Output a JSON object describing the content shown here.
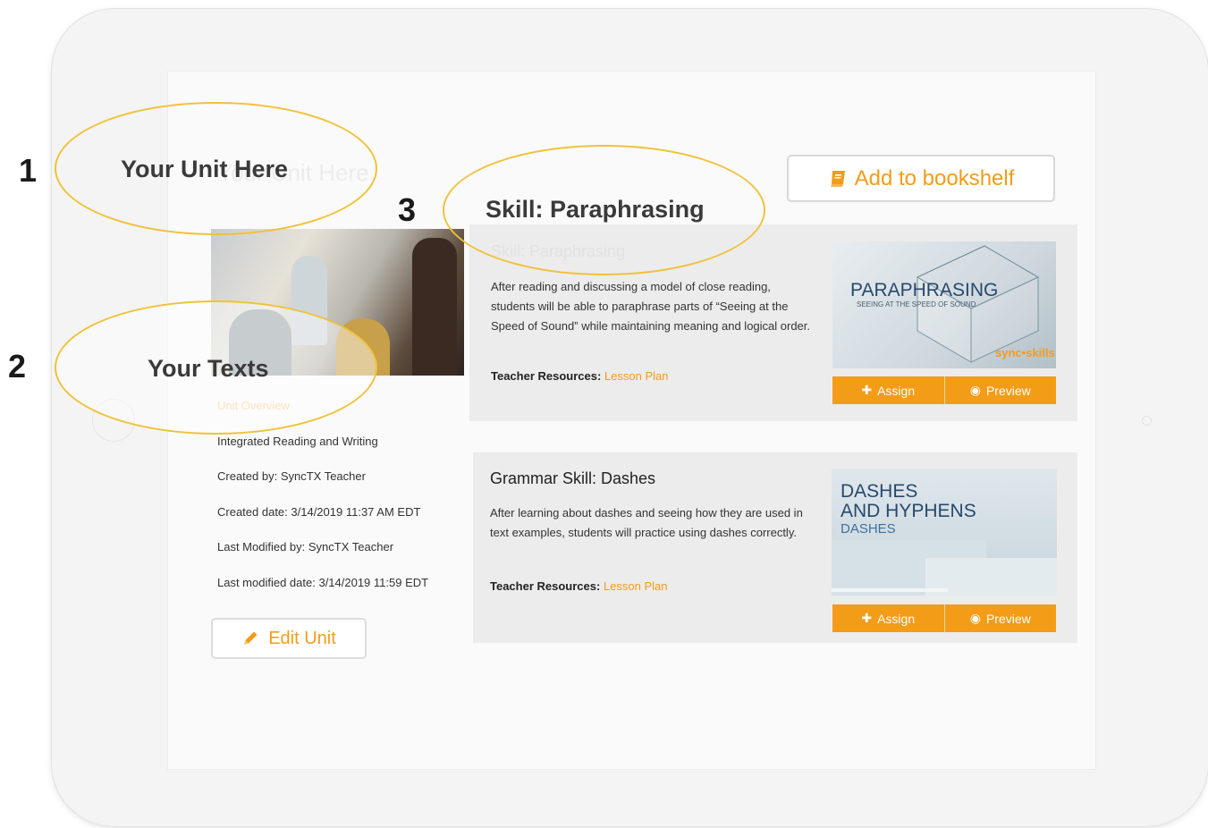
{
  "annotations": [
    {
      "number": "1",
      "label": "Your Unit Here"
    },
    {
      "number": "2",
      "label": "Your Texts"
    },
    {
      "number": "3",
      "label": "Skill: Paraphrasing"
    }
  ],
  "header": {
    "unit_title": "Your Unit Here",
    "add_bookshelf_label": "Add to bookshelf"
  },
  "unit": {
    "overview_link": "Unit Overview",
    "meta": [
      "Integrated Reading and Writing",
      "Created by: SyncTX Teacher",
      "Created date: 3/14/2019 11:37 AM EDT",
      "Last Modified by: SyncTX Teacher",
      "Last modified date: 3/14/2019 11:59 EDT"
    ],
    "edit_label": "Edit Unit"
  },
  "lessons": [
    {
      "title": "Skill: Paraphrasing",
      "description": "After reading and discussing a model of close reading, students will be able to paraphrase parts of “Seeing at the Speed of Sound” while maintaining meaning and logical order.",
      "resources_label": "Teacher Resources:",
      "resources_link": "Lesson Plan",
      "thumb_title": "PARAPHRASING",
      "thumb_subtitle": "SEEING AT THE SPEED OF SOUND",
      "thumb_brand": "sync•skills",
      "assign_label": "Assign",
      "preview_label": "Preview"
    },
    {
      "title": "Grammar Skill: Dashes",
      "description": "After learning about dashes and seeing how they are used in text examples, students will practice using dashes correctly.",
      "resources_label": "Teacher Resources:",
      "resources_link": "Lesson Plan",
      "thumb_title_1": "DASHES",
      "thumb_title_2": "AND HYPHENS",
      "thumb_subtitle": "DASHES",
      "assign_label": "Assign",
      "preview_label": "Preview"
    }
  ],
  "colors": {
    "accent": "#f39c18",
    "annotation_ring": "#f0c23a",
    "thumb_title": "#27496d"
  }
}
